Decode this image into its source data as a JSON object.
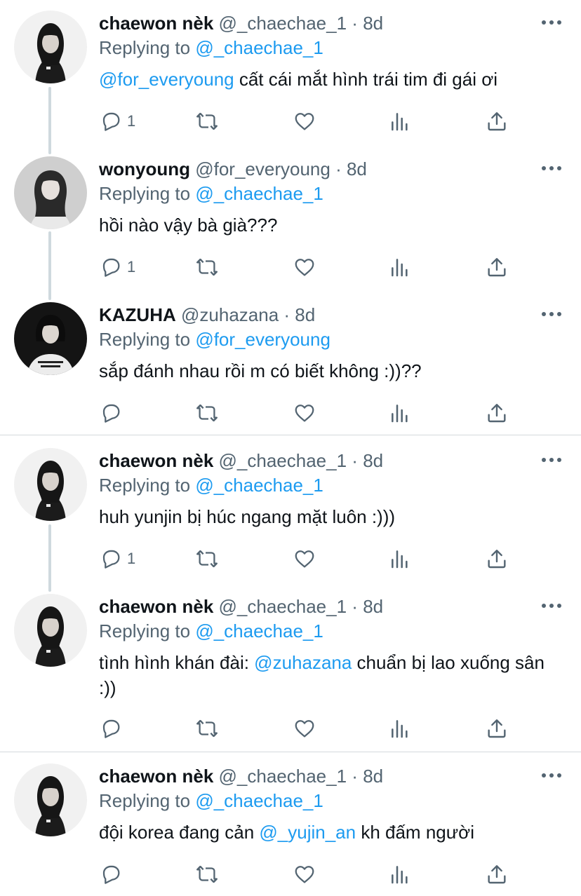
{
  "tweets": [
    {
      "name": "chaewon nèk",
      "handle": "@_chaechae_1",
      "time": "8d",
      "replying_label": "Replying to",
      "replying_to": "@_chaechae_1",
      "text": [
        {
          "t": "@for_everyoung",
          "link": true
        },
        {
          "t": " cất cái mắt hình trái tim đi gái ơi",
          "link": false
        }
      ],
      "reply_count": "1",
      "avatar": "chaewon"
    },
    {
      "name": "wonyoung",
      "handle": "@for_everyoung",
      "time": "8d",
      "replying_label": "Replying to",
      "replying_to": "@_chaechae_1",
      "text": [
        {
          "t": "hồi nào vậy bà già???",
          "link": false
        }
      ],
      "reply_count": "1",
      "avatar": "wonyoung"
    },
    {
      "name": "KAZUHA",
      "handle": "@zuhazana",
      "time": "8d",
      "replying_label": "Replying to",
      "replying_to": "@for_everyoung",
      "text": [
        {
          "t": "sắp đánh nhau rồi m có biết không :))??",
          "link": false
        }
      ],
      "reply_count": "",
      "avatar": "kazuha"
    },
    {
      "name": "chaewon nèk",
      "handle": "@_chaechae_1",
      "time": "8d",
      "replying_label": "Replying to",
      "replying_to": "@_chaechae_1",
      "text": [
        {
          "t": "huh yunjin bị húc ngang mặt luôn :)))",
          "link": false
        }
      ],
      "reply_count": "1",
      "avatar": "chaewon"
    },
    {
      "name": "chaewon nèk",
      "handle": "@_chaechae_1",
      "time": "8d",
      "replying_label": "Replying to",
      "replying_to": "@_chaechae_1",
      "text": [
        {
          "t": "tình hình khán đài: ",
          "link": false
        },
        {
          "t": "@zuhazana",
          "link": true
        },
        {
          "t": " chuẩn bị lao xuống sân :))",
          "link": false
        }
      ],
      "reply_count": "",
      "avatar": "chaewon"
    },
    {
      "name": "chaewon nèk",
      "handle": "@_chaechae_1",
      "time": "8d",
      "replying_label": "Replying to",
      "replying_to": "@_chaechae_1",
      "text": [
        {
          "t": "đội korea đang cản ",
          "link": false
        },
        {
          "t": "@_yujin_an",
          "link": true
        },
        {
          "t": " kh đấm người",
          "link": false
        }
      ],
      "reply_count": "",
      "avatar": "chaewon"
    }
  ],
  "icons": {
    "reply": "reply-icon",
    "retweet": "retweet-icon",
    "like": "like-icon",
    "views": "views-icon",
    "share": "share-icon",
    "more": "more-icon"
  },
  "colors": {
    "link": "#1d9bf0",
    "secondary_text": "#536471",
    "primary_text": "#0f1419",
    "thread_line": "#cfd9de"
  }
}
